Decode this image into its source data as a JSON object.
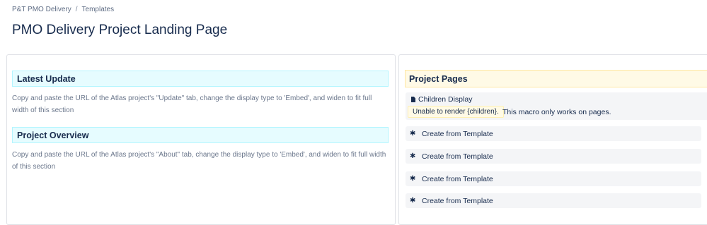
{
  "breadcrumb": {
    "items": [
      "P&T PMO Delivery",
      "Templates"
    ],
    "separator": "/"
  },
  "page": {
    "title": "PMO Delivery Project Landing Page"
  },
  "left": {
    "sections": [
      {
        "heading": "Latest Update",
        "text": "Copy and paste the URL of the Atlas project's \"Update\" tab, change the display type to 'Embed', and widen to fit full width of this section"
      },
      {
        "heading": "Project Overview",
        "text": "Copy and paste the URL of the Atlas project's \"About\" tab, change the display type to 'Embed', and widen to fit full width of this section"
      }
    ]
  },
  "right": {
    "heading": "Project Pages",
    "macro": {
      "title": "Children Display",
      "error": "Unable to render {children}.",
      "note": "This macro only works on pages."
    },
    "template_buttons": [
      "Create from Template",
      "Create from Template",
      "Create from Template",
      "Create from Template"
    ]
  },
  "colors": {
    "info_panel_bg": "#e6fcff",
    "note_panel_bg": "#fffae6",
    "text": "#172b4d",
    "muted": "#6b778c"
  },
  "icons": {
    "macro": "document-icon",
    "template": "puzzle-icon"
  }
}
